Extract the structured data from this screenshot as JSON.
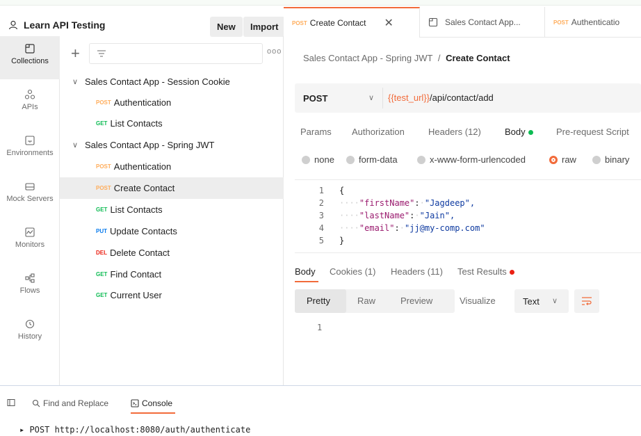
{
  "workspace": {
    "title": "Learn API Testing",
    "new_label": "New",
    "import_label": "Import"
  },
  "sidebar_nav": [
    {
      "label": "Collections",
      "icon": "collections-icon",
      "active": true
    },
    {
      "label": "APIs",
      "icon": "apis-icon"
    },
    {
      "label": "Environments",
      "icon": "environments-icon"
    },
    {
      "label": "Mock Servers",
      "icon": "mock-servers-icon"
    },
    {
      "label": "Monitors",
      "icon": "monitors-icon"
    },
    {
      "label": "Flows",
      "icon": "flows-icon"
    },
    {
      "label": "History",
      "icon": "history-icon"
    }
  ],
  "tree": [
    {
      "type": "folder",
      "label": "Sales Contact App - Session Cookie"
    },
    {
      "type": "request",
      "method": "POST",
      "label": "Authentication"
    },
    {
      "type": "request",
      "method": "GET",
      "label": "List Contacts"
    },
    {
      "type": "folder",
      "label": "Sales Contact App - Spring JWT"
    },
    {
      "type": "request",
      "method": "POST",
      "label": "Authentication"
    },
    {
      "type": "request",
      "method": "POST",
      "label": "Create Contact",
      "selected": true
    },
    {
      "type": "request",
      "method": "GET",
      "label": "List Contacts"
    },
    {
      "type": "request",
      "method": "PUT",
      "label": "Update Contacts"
    },
    {
      "type": "request",
      "method": "DEL",
      "label": "Delete Contact"
    },
    {
      "type": "request",
      "method": "GET",
      "label": "Find Contact"
    },
    {
      "type": "request",
      "method": "GET",
      "label": "Current User"
    }
  ],
  "tabs": [
    {
      "method": "POST",
      "label": "Create Contact"
    },
    {
      "label": "Sales Contact App..."
    },
    {
      "method": "POST",
      "label": "Authenticatio"
    }
  ],
  "breadcrumb": {
    "parent": "Sales Contact App - Spring JWT",
    "separator": "/",
    "current": "Create Contact"
  },
  "request": {
    "method": "POST",
    "url_var": "{{test_url}}",
    "url_path": "/api/contact/add"
  },
  "request_tabs": [
    "Params",
    "Authorization",
    "Headers (12)",
    "Body",
    "Pre-request Script"
  ],
  "body_types": [
    "none",
    "form-data",
    "x-www-form-urlencoded",
    "raw",
    "binary"
  ],
  "body_selected": "raw",
  "body_code": [
    {
      "line": "1",
      "text": "{"
    },
    {
      "line": "2",
      "key": "\"firstName\"",
      "value": "\"Jagdeep\","
    },
    {
      "line": "3",
      "key": "\"lastName\"",
      "value": "\"Jain\","
    },
    {
      "line": "4",
      "key": "\"email\"",
      "value": "\"jj@my-comp.com\""
    },
    {
      "line": "5",
      "text": "}"
    }
  ],
  "response_tabs": [
    "Body",
    "Cookies (1)",
    "Headers (11)",
    "Test Results"
  ],
  "view_modes": [
    "Pretty",
    "Raw",
    "Preview",
    "Visualize"
  ],
  "format_label": "Text",
  "response_line": "1",
  "bottom_bar": {
    "find_replace": "Find and Replace",
    "console": "Console"
  },
  "console_log": "▸ POST http://localhost:8080/auth/authenticate",
  "colors": {
    "accent": "#f26b3a",
    "post": "#ffad5b",
    "get": "#0cbb52",
    "put": "#097bed",
    "delete": "#eb2013"
  }
}
